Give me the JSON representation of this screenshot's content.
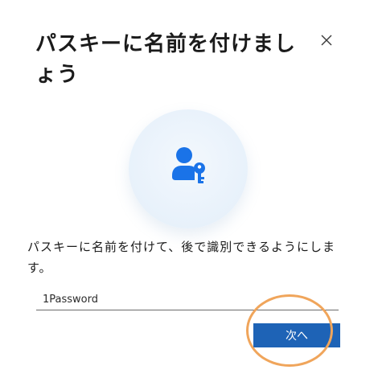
{
  "dialog": {
    "title": "パスキーに名前を付けましょう",
    "close_icon": "close-icon",
    "hero_icon": "person-key-icon",
    "description": "パスキーに名前を付けて、後で識別できるようにします。",
    "name_input": {
      "value": "1Password"
    },
    "next_label": "次へ"
  },
  "colors": {
    "accent": "#1e63b6",
    "highlight": "#f0a55b"
  }
}
